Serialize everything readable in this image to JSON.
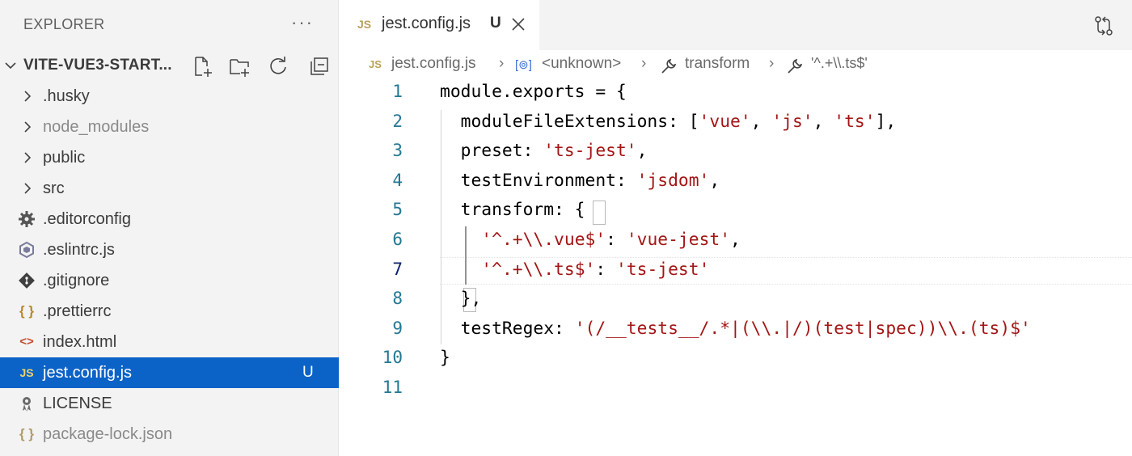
{
  "sidebar": {
    "title": "EXPLORER",
    "more": "···",
    "folder": {
      "name": "VITE-VUE3-START..."
    },
    "items": [
      {
        "label": ".husky",
        "kind": "folder",
        "dim": false
      },
      {
        "label": "node_modules",
        "kind": "folder",
        "dim": true
      },
      {
        "label": "public",
        "kind": "folder",
        "dim": false
      },
      {
        "label": "src",
        "kind": "folder",
        "dim": false
      },
      {
        "label": ".editorconfig",
        "kind": "gear-icon",
        "dim": false
      },
      {
        "label": ".eslintrc.js",
        "kind": "eslint-icon",
        "dim": false
      },
      {
        "label": ".gitignore",
        "kind": "git-icon",
        "dim": false
      },
      {
        "label": ".prettierrc",
        "kind": "braces-icon",
        "dim": false
      },
      {
        "label": "index.html",
        "kind": "html-icon",
        "dim": false
      },
      {
        "label": "jest.config.js",
        "kind": "js-icon",
        "dim": false,
        "selected": true,
        "badge": "U"
      },
      {
        "label": "LICENSE",
        "kind": "license-icon",
        "dim": false
      },
      {
        "label": "package-lock.json",
        "kind": "braces-icon",
        "dim": true
      }
    ]
  },
  "tab": {
    "icon": "JS",
    "title": "jest.config.js",
    "modified": "U"
  },
  "breadcrumb": {
    "file_icon": "JS",
    "file": "jest.config.js",
    "sym1_icon": "[⊚]",
    "sym1": "<unknown>",
    "sym2": "transform",
    "sym3": "'^.+\\\\.ts$'"
  },
  "editor": {
    "line_numbers": [
      "1",
      "2",
      "3",
      "4",
      "5",
      "6",
      "7",
      "8",
      "9",
      "10",
      "11"
    ],
    "active_line": 7,
    "lines": [
      [
        {
          "t": "module.exports = {"
        }
      ],
      [
        {
          "t": "  moduleFileExtensions: ["
        },
        {
          "t": "'vue'",
          "s": 1
        },
        {
          "t": ", "
        },
        {
          "t": "'js'",
          "s": 1
        },
        {
          "t": ", "
        },
        {
          "t": "'ts'",
          "s": 1
        },
        {
          "t": "],"
        }
      ],
      [
        {
          "t": "  preset: "
        },
        {
          "t": "'ts-jest'",
          "s": 1
        },
        {
          "t": ","
        }
      ],
      [
        {
          "t": "  testEnvironment: "
        },
        {
          "t": "'jsdom'",
          "s": 1
        },
        {
          "t": ","
        }
      ],
      [
        {
          "t": "  transform: {"
        }
      ],
      [
        {
          "t": "    "
        },
        {
          "t": "'^.+\\\\.vue$'",
          "s": 1
        },
        {
          "t": ": "
        },
        {
          "t": "'vue-jest'",
          "s": 1
        },
        {
          "t": ","
        }
      ],
      [
        {
          "t": "    "
        },
        {
          "t": "'^.+\\\\.ts$'",
          "s": 1
        },
        {
          "t": ": "
        },
        {
          "t": "'ts-jest'",
          "s": 1
        }
      ],
      [
        {
          "t": "  },"
        }
      ],
      [
        {
          "t": "  testRegex: "
        },
        {
          "t": "'(/__tests__/.*|(\\\\.|/)(test|spec))\\\\.(ts)$'",
          "s": 1
        }
      ],
      [
        {
          "t": "}"
        }
      ],
      [
        {
          "t": ""
        }
      ]
    ]
  },
  "colors": {
    "selection": "#0b63c7",
    "string": "#a31515",
    "line_number": "#237893"
  }
}
